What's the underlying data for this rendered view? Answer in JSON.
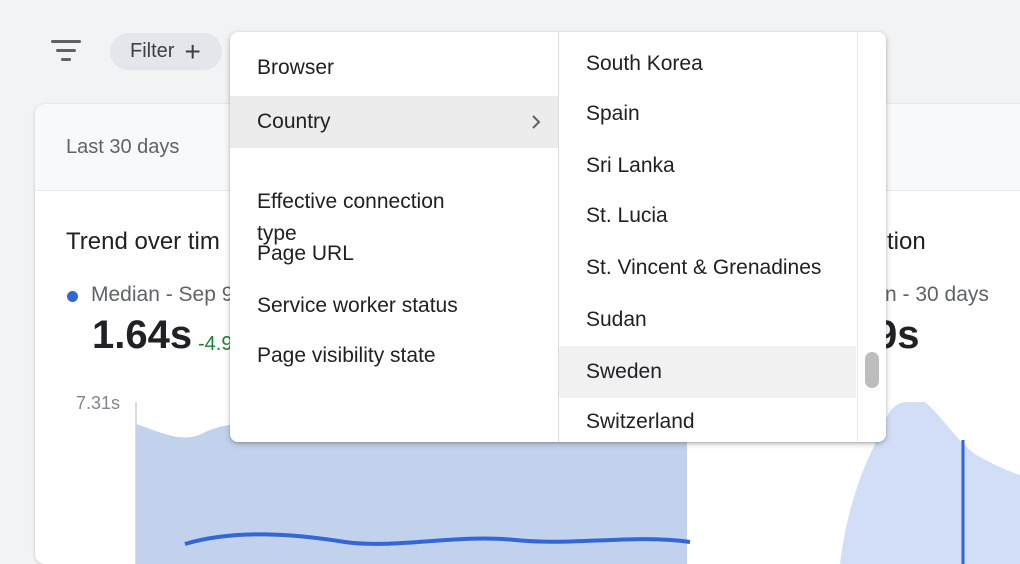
{
  "toolbar": {
    "filter_icon": "filter-list-icon",
    "filter_chip_label": "Filter",
    "plus_icon": "plus-icon"
  },
  "card": {
    "date_range": "Last 30 days",
    "trend": {
      "title": "Trend over tim",
      "legend_label": "Median - Sep 9",
      "value": "1.64s",
      "delta": "-4.9",
      "y_max_label": "7.31s",
      "series_color": "#3367d6"
    },
    "distribution": {
      "title": "tion",
      "legend_label": "n - 30 days",
      "value": "9s"
    }
  },
  "menu": {
    "left_items": [
      {
        "label": "Browser"
      },
      {
        "label": "Country",
        "active": true,
        "chevron_icon": "chevron-right-icon"
      },
      {
        "label": "Effective connection\ntype"
      },
      {
        "label": "Page URL"
      },
      {
        "label": "Service worker status"
      },
      {
        "label": "Page visibility state"
      }
    ],
    "countries": [
      "South Korea",
      "Spain",
      "Sri Lanka",
      "St. Lucia",
      "St. Vincent & Grenadines",
      "Sudan",
      "Sweden",
      "Switzerland"
    ],
    "hovered_country": "Sweden"
  },
  "colors": {
    "accent": "#3367d6",
    "chart_fill": "#c2d1ec",
    "chart_fill_light": "#d2def7",
    "delta_positive": "#188038"
  }
}
